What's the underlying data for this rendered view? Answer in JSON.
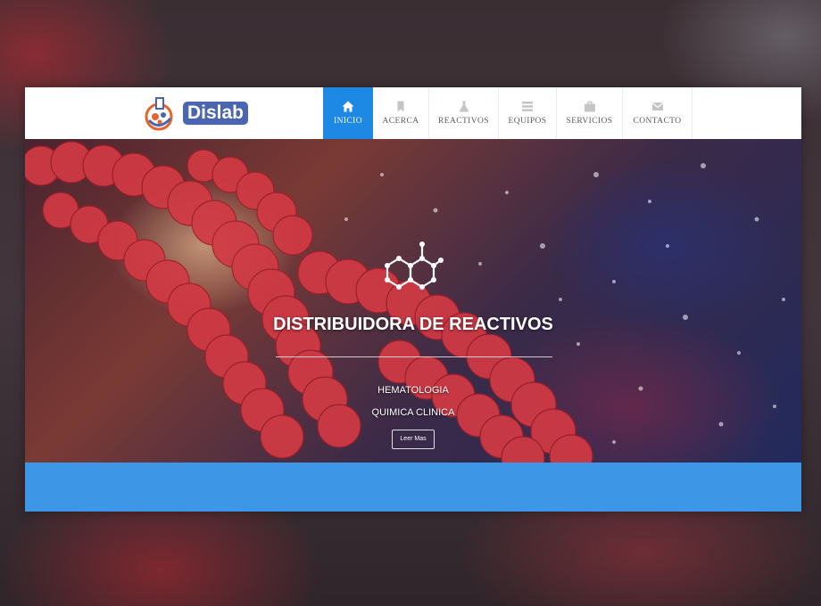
{
  "brand": {
    "name": "Dislab",
    "accent_color": "#4a66b0",
    "logo_icon": "flask-molecule-logo-icon"
  },
  "nav": {
    "active_color": "#1e88e5",
    "items": [
      {
        "label": "INICIO",
        "icon": "home-icon",
        "active": true
      },
      {
        "label": "ACERCA",
        "icon": "bookmark-icon",
        "active": false
      },
      {
        "label": "REACTIVOS",
        "icon": "flask-icon",
        "active": false
      },
      {
        "label": "EQUIPOS",
        "icon": "list-icon",
        "active": false
      },
      {
        "label": "SERVICIOS",
        "icon": "briefcase-icon",
        "active": false
      },
      {
        "label": "CONTACTO",
        "icon": "envelope-icon",
        "active": false
      }
    ]
  },
  "hero": {
    "icon": "molecule-icon",
    "title": "DISTRIBUIDORA DE REACTIVOS",
    "line1": "HEMATOLOGIA",
    "line2": "QUIMICA CLINICA",
    "button_label": "Leer Mas"
  },
  "band": {
    "color": "#3d97e6"
  }
}
